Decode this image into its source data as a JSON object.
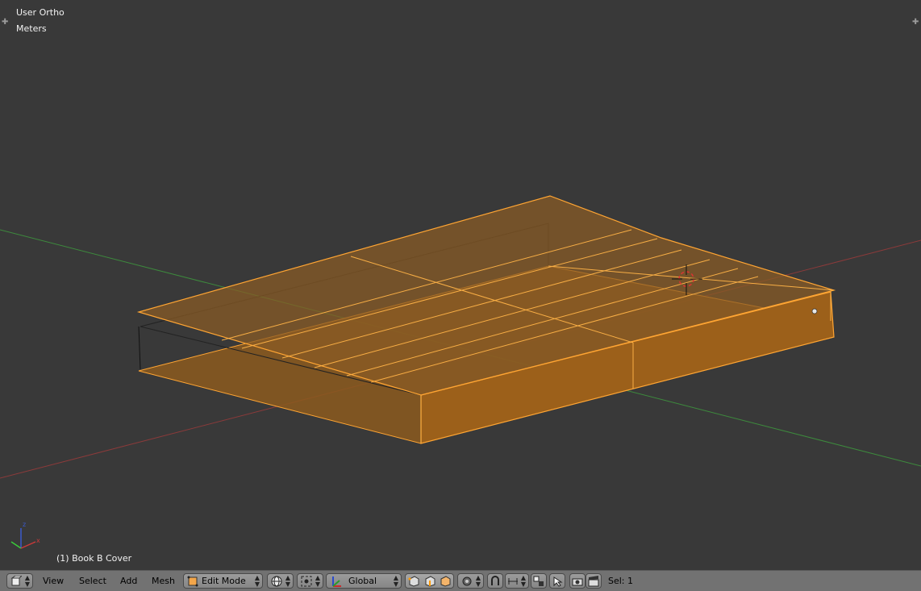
{
  "viewport": {
    "view_name": "User Ortho",
    "units": "Meters",
    "object_info": "(1) Book B Cover"
  },
  "axes_gizmo": {
    "x_label": "x",
    "z_label": "z"
  },
  "header": {
    "menus": {
      "view": "View",
      "select": "Select",
      "add": "Add",
      "mesh": "Mesh"
    },
    "mode": "Edit Mode",
    "orientation": "Global",
    "selection_status": "Sel: 1"
  },
  "colors": {
    "viewport_bg": "#393939",
    "selected_wire": "#ffa533",
    "selected_face": "#8c5a1e",
    "axis_x": "#8a3a3a",
    "axis_y": "#3d8a3d",
    "header_bg": "#727272"
  },
  "icons": [
    "editor-type-icon",
    "edit-mode-icon",
    "shading-icon",
    "pivot-icon",
    "manipulator-icon",
    "vertex-select-icon",
    "edge-select-icon",
    "face-select-icon",
    "proportional-edit-icon",
    "snap-icon",
    "snap-element-icon",
    "mirror-icon",
    "render-icon",
    "camera-icon",
    "clapper-icon",
    "3d-cursor-icon"
  ]
}
